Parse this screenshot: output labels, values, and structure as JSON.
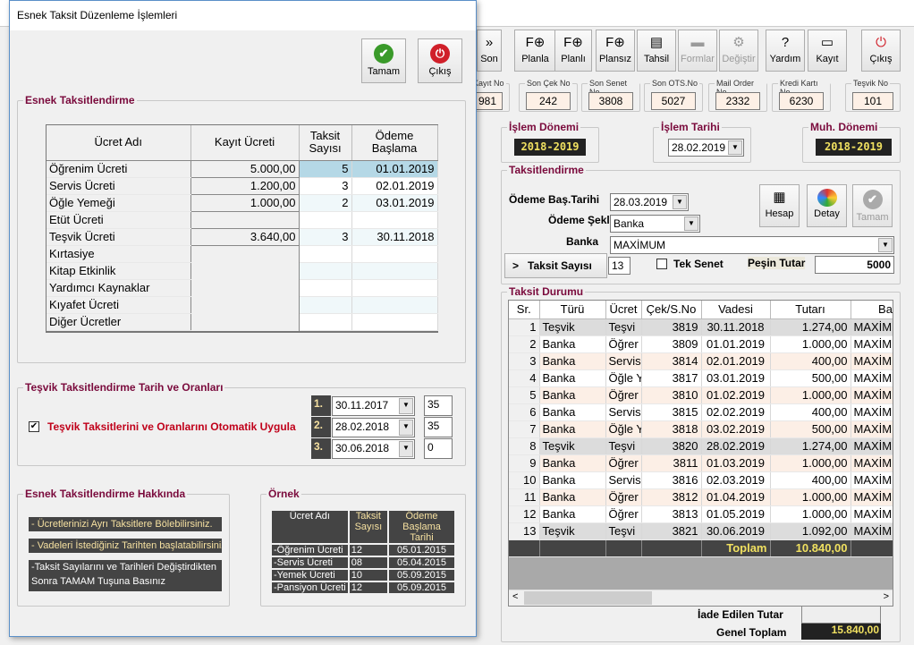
{
  "toolbar": {
    "buttons": [
      {
        "label": "Son",
        "icon": "double-chevron-icon",
        "enabled": true
      },
      {
        "label": "Planla",
        "icon": "form-add-icon",
        "enabled": true
      },
      {
        "label": "Planlı",
        "icon": "form-add-icon",
        "enabled": true
      },
      {
        "label": "Plansız",
        "icon": "form-add-icon",
        "enabled": true
      },
      {
        "label": "Tahsil",
        "icon": "cash-register-icon",
        "enabled": true
      },
      {
        "label": "Formlar",
        "icon": "folder-icon",
        "enabled": false
      },
      {
        "label": "Değiştir",
        "icon": "gear-icon",
        "enabled": false
      },
      {
        "label": "Yardım",
        "icon": "help-icon",
        "enabled": true
      },
      {
        "label": "Kayıt",
        "icon": "save-icon",
        "enabled": true
      },
      {
        "label": "Çıkış",
        "icon": "power-icon",
        "enabled": true
      }
    ]
  },
  "counters": [
    {
      "label": "Kayıt No",
      "value": "981"
    },
    {
      "label": "Son Çek No",
      "value": "242"
    },
    {
      "label": "Son Senet No",
      "value": "3808"
    },
    {
      "label": "Son OTS.No",
      "value": "5027"
    },
    {
      "label": "Mail Order No",
      "value": "2332"
    },
    {
      "label": "Kredi Kartı No",
      "value": "6230"
    },
    {
      "label": "Teşvik No",
      "value": "101"
    }
  ],
  "period": {
    "islem_donemi_label": "İşlem Dönemi",
    "islem_donemi": "2018-2019",
    "islem_tarihi_label": "İşlem Tarihi",
    "islem_tarihi": "28.02.2019",
    "muh_donemi_label": "Muh. Dönemi",
    "muh_donemi": "2018-2019"
  },
  "taksitlendirme": {
    "title": "Taksitlendirme",
    "odeme_bas_label": "Ödeme Baş.Tarihi",
    "odeme_bas": "28.03.2019",
    "odeme_sekli_label": "Ödeme Şekli",
    "odeme_sekli": "Banka",
    "banka_label": "Banka",
    "banka": "MAXİMUM",
    "taksit_sayisi_button": "Taksit Sayısı",
    "taksit_sayisi_prefix": ">",
    "taksit_sayisi": "13",
    "tek_senet_label": "Tek Senet",
    "tek_senet_checked": false,
    "pesin_label": "Peşin Tutar",
    "pesin": "5000",
    "hesap": "Hesap",
    "detay": "Detay",
    "tamam": "Tamam"
  },
  "durum": {
    "title": "Taksit Durumu",
    "columns": [
      "Sr.",
      "Türü",
      "Ücret",
      "Çek/S.No",
      "Vadesi",
      "Tutarı",
      "Ba"
    ],
    "rows": [
      [
        "1",
        "Teşvik",
        "Teşvi",
        "3819",
        "30.11.2018",
        "1.274,00",
        "MAXİMU"
      ],
      [
        "2",
        "Banka",
        "Öğrer",
        "3809",
        "01.01.2019",
        "1.000,00",
        "MAXİMU"
      ],
      [
        "3",
        "Banka",
        "Servis",
        "3814",
        "02.01.2019",
        "400,00",
        "MAXİMU"
      ],
      [
        "4",
        "Banka",
        "Öğle Y",
        "3817",
        "03.01.2019",
        "500,00",
        "MAXİMU"
      ],
      [
        "5",
        "Banka",
        "Öğrer",
        "3810",
        "01.02.2019",
        "1.000,00",
        "MAXİMU"
      ],
      [
        "6",
        "Banka",
        "Servis",
        "3815",
        "02.02.2019",
        "400,00",
        "MAXİMU"
      ],
      [
        "7",
        "Banka",
        "Öğle Y",
        "3818",
        "03.02.2019",
        "500,00",
        "MAXİMU"
      ],
      [
        "8",
        "Teşvik",
        "Teşvi",
        "3820",
        "28.02.2019",
        "1.274,00",
        "MAXİMU"
      ],
      [
        "9",
        "Banka",
        "Öğrer",
        "3811",
        "01.03.2019",
        "1.000,00",
        "MAXİMU"
      ],
      [
        "10",
        "Banka",
        "Servis",
        "3816",
        "02.03.2019",
        "400,00",
        "MAXİMU"
      ],
      [
        "11",
        "Banka",
        "Öğrer",
        "3812",
        "01.04.2019",
        "1.000,00",
        "MAXİMU"
      ],
      [
        "12",
        "Banka",
        "Öğrer",
        "3813",
        "01.05.2019",
        "1.000,00",
        "MAXİMU"
      ],
      [
        "13",
        "Teşvik",
        "Teşvi",
        "3821",
        "30.06.2019",
        "1.092,00",
        "MAXİMU"
      ]
    ],
    "total_label": "Toplam",
    "total": "10.840,00",
    "iade_label": "İade Edilen Tutar",
    "iade": "",
    "genel_label": "Genel Toplam",
    "genel": "15.840,00"
  },
  "dialog": {
    "title": "Esnek Taksit Düzenleme İşlemleri",
    "tamam": "Tamam",
    "cikis": "Çıkış",
    "esnek": {
      "title": "Esnek Taksitlendirme",
      "columns": [
        "Ücret Adı",
        "Kayıt Ücreti",
        "Taksit Sayısı",
        "Ödeme Başlama"
      ],
      "rows": [
        [
          "Öğrenim Ücreti",
          "5.000,00",
          "5",
          "01.01.2019"
        ],
        [
          "Servis Ücreti",
          "1.200,00",
          "3",
          "02.01.2019"
        ],
        [
          "Öğle Yemeği",
          "1.000,00",
          "2",
          "03.01.2019"
        ],
        [
          "Etüt Ücreti",
          "",
          "",
          ""
        ],
        [
          "Teşvik Ücreti",
          "3.640,00",
          "3",
          "30.11.2018"
        ],
        [
          "Kırtasiye",
          "",
          "",
          ""
        ],
        [
          "Kitap Etkinlik",
          "",
          "",
          ""
        ],
        [
          "Yardımcı Kaynaklar",
          "",
          "",
          ""
        ],
        [
          "Kıyafet Ücreti",
          "",
          "",
          ""
        ],
        [
          "Diğer Ücretler",
          "",
          "",
          ""
        ]
      ]
    },
    "tesvik": {
      "title": "Teşvik Taksitlendirme Tarih ve Oranları",
      "auto_label": "Teşvik Taksitlerini ve Oranlarını Otomatik Uygula",
      "auto_checked": true,
      "items": [
        {
          "no": "1.",
          "date": "30.11.2017",
          "rate": "35"
        },
        {
          "no": "2.",
          "date": "28.02.2018",
          "rate": "35"
        },
        {
          "no": "3.",
          "date": "30.06.2018",
          "rate": "0"
        }
      ]
    },
    "hakkinda": {
      "title": "Esnek Taksitlendirme Hakkında",
      "lines": [
        "- Ücretlerinizi Ayrı Taksitlere Bölebilirsiniz.",
        "- Vadeleri İstediğiniz Tarihten başlatabilirsiniz",
        "-Taksit Sayılarını ve Tarihleri Değiştirdikten",
        "Sonra TAMAM Tuşuna Basınız"
      ]
    },
    "ornek": {
      "title": "Örnek",
      "columns": [
        "Ücret Adı",
        "Taksit Sayısı",
        "Ödeme Başlama Tarihi"
      ],
      "rows": [
        [
          "-Öğrenim Ücreti",
          "12",
          "05.01.2015"
        ],
        [
          "-Servis Ücreti",
          "08",
          "05.04.2015"
        ],
        [
          "-Yemek Ücreti",
          "10",
          "05.09.2015"
        ],
        [
          "-Pansiyon Ücreti",
          "12",
          "05.09.2015"
        ]
      ]
    }
  }
}
